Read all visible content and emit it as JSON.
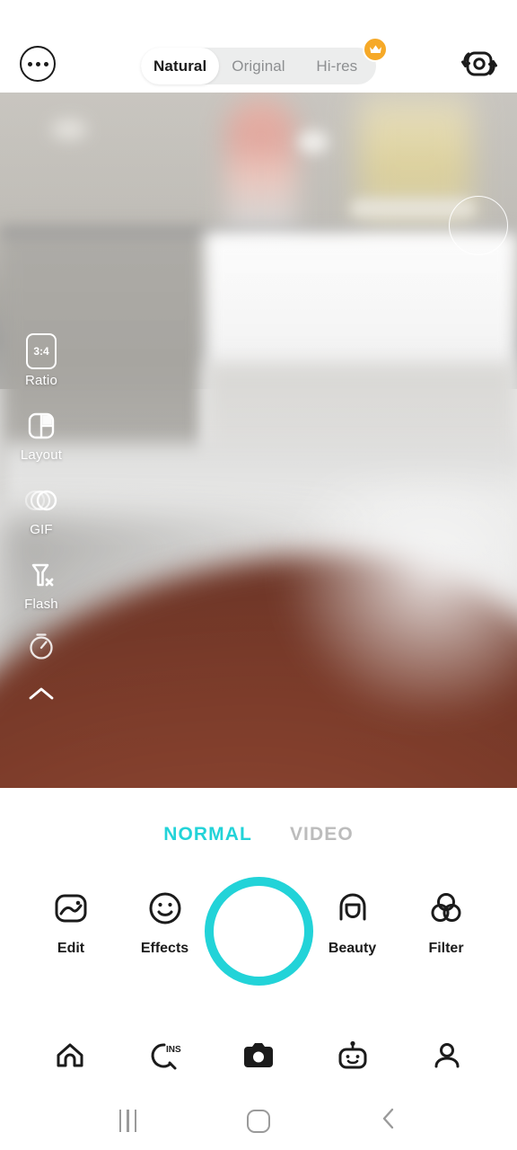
{
  "app": {
    "name": "Camera"
  },
  "topbar": {
    "more_button": "more-options",
    "flip_button": "switch-camera",
    "quality_modes": [
      {
        "label": "Natural",
        "selected": true,
        "premium": false
      },
      {
        "label": "Original",
        "selected": false,
        "premium": false
      },
      {
        "label": "Hi-res",
        "selected": false,
        "premium": true
      }
    ],
    "premium_badge_icon": "crown-icon"
  },
  "viewfinder": {
    "focus_ring": "focus-ring",
    "expand_button_icon": "expand-diagonal-icon",
    "scene_description": "blurred close-up of a bathroom counter with a pink bottle and yellow jar"
  },
  "rail": {
    "items": [
      {
        "label": "Ratio",
        "icon": "aspect-ratio-icon",
        "value": "3:4"
      },
      {
        "label": "Layout",
        "icon": "layout-icon",
        "value": ""
      },
      {
        "label": "GIF",
        "icon": "gif-icon",
        "value": ""
      },
      {
        "label": "Flash",
        "icon": "flash-off-icon",
        "value": ""
      },
      {
        "label": "",
        "icon": "timer-icon",
        "value": ""
      },
      {
        "label": "",
        "icon": "chevron-up-icon",
        "value": ""
      }
    ]
  },
  "capture": {
    "tabs": [
      {
        "label": "NORMAL",
        "active": true
      },
      {
        "label": "VIDEO",
        "active": false
      }
    ],
    "shutter_label": "shutter-button",
    "actions": [
      {
        "label": "Edit",
        "icon": "image-edit-icon"
      },
      {
        "label": "Effects",
        "icon": "smiley-face-icon"
      },
      {
        "label": "Beauty",
        "icon": "beauty-face-icon"
      },
      {
        "label": "Filter",
        "icon": "filter-circles-icon"
      }
    ]
  },
  "app_nav": {
    "items": [
      {
        "name": "home",
        "icon": "home-icon",
        "active": false
      },
      {
        "name": "inspire",
        "icon": "ins-search-icon",
        "active": false
      },
      {
        "name": "camera",
        "icon": "camera-icon",
        "active": true
      },
      {
        "name": "ai",
        "icon": "robot-icon",
        "active": false
      },
      {
        "name": "profile",
        "icon": "person-icon",
        "active": false
      }
    ]
  },
  "system_nav": {
    "recents": "recents-button",
    "home": "home-button",
    "back": "back-button"
  },
  "colors": {
    "accent": "#22d3d8",
    "premium": "#f6a928",
    "ink": "#1b1b1b",
    "muted": "#8d8f91"
  }
}
